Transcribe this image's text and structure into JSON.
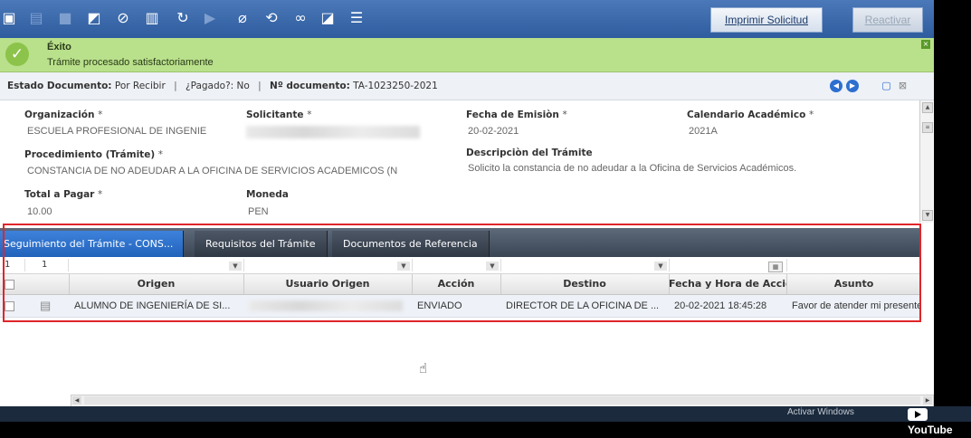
{
  "toolbar": {
    "icons": [
      "new-icon",
      "list-icon",
      "save-icon",
      "save-edit-icon",
      "cancel-icon",
      "delete-icon",
      "refresh-icon",
      "copy-icon",
      "attach-icon",
      "workflow-icon",
      "link-icon",
      "report-icon",
      "form-icon"
    ],
    "print_button": "Imprimir Solicitud",
    "reactivate_button": "Reactivar"
  },
  "banner": {
    "title": "Éxito",
    "message": "Trámite procesado satisfactoriamente"
  },
  "status": {
    "estado_label": "Estado Documento:",
    "estado_value": "Por Recibir",
    "pagado_label": "¿Pagado?:",
    "pagado_value": "No",
    "doc_label": "Nº documento:",
    "doc_value": "TA-1023250-2021"
  },
  "form": {
    "organizacion_label": "Organización",
    "organizacion_value": "ESCUELA PROFESIONAL DE INGENIE",
    "solicitante_label": "Solicitante",
    "fecha_label": "Fecha de Emisiòn",
    "fecha_value": "20-02-2021",
    "calendario_label": "Calendario Académico",
    "calendario_value": "2021A",
    "procedimiento_label": "Procedimiento (Trámite)",
    "procedimiento_value": "CONSTANCIA DE NO ADEUDAR A LA OFICINA DE SERVICIOS ACADEMICOS (N",
    "descripcion_label": "Descripciòn del Trámite",
    "descripcion_value": "Solicito la constancia de no adeudar a la Oficina de Servicios Académicos.",
    "total_label": "Total a Pagar",
    "total_value": "10.00",
    "moneda_label": "Moneda",
    "moneda_value": "PEN",
    "required_mark": "*"
  },
  "tabs": [
    {
      "label": "Seguimiento del Trámite - CONS..."
    },
    {
      "label": "Requisitos del Trámite"
    },
    {
      "label": "Documentos de Referencia"
    }
  ],
  "grid": {
    "filter_values": [
      "1",
      "1"
    ],
    "headers": [
      "Origen",
      "Usuario Origen",
      "Acción",
      "Destino",
      "Fecha y Hora de Acción",
      "Asunto"
    ],
    "rows": [
      {
        "origen": "ALUMNO DE INGENIERÍA DE SI...",
        "accion": "ENVIADO",
        "destino": "DIRECTOR DE LA OFICINA DE ...",
        "fecha": "20-02-2021 18:45:28",
        "asunto": "Favor de atender mi presente so"
      }
    ]
  },
  "footer": {
    "activate_windows": "Activar Windows",
    "youtube": "YouTube"
  },
  "colors": {
    "toolbar": "#2e5c9e",
    "banner": "#b9e08b",
    "active_tab": "#2262bb",
    "highlight_outline": "#e0252a"
  }
}
